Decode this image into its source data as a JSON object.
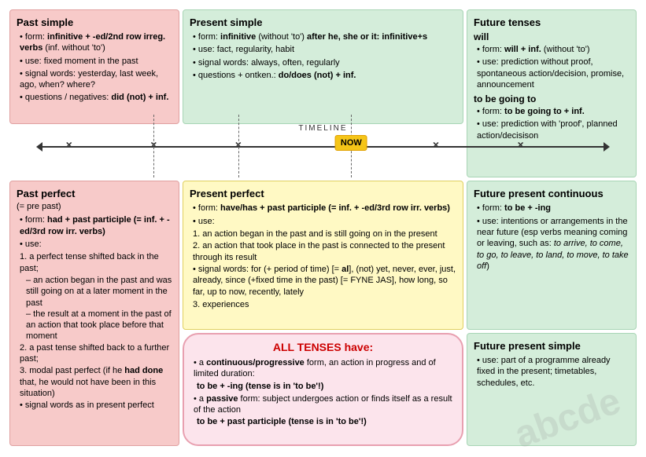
{
  "past_simple": {
    "title": "Past simple",
    "items": [
      {
        "text": "form: ",
        "bold": "infinitive + -ed/2nd row irreg. verbs",
        "rest": " (inf. without 'to')"
      },
      {
        "text": "use: fixed moment in the past"
      },
      {
        "text": "signal words: yesterday, last week, ago, when? where?"
      },
      {
        "text": "questions / negatives: ",
        "bold": "did (not) + inf."
      }
    ]
  },
  "present_simple": {
    "title": "Present simple",
    "items": [
      {
        "text": "form: ",
        "bold": "infinitive",
        "rest": " (without 'to') after he, she or it: ",
        "bold2": "infinitive+s"
      },
      {
        "text": "use: fact, regularity, habit"
      },
      {
        "text": "signal words: always, often, regularly"
      },
      {
        "text": "questions + ontken.: ",
        "bold": "do/does (not) + inf."
      }
    ]
  },
  "future_tenses": {
    "title": "Future tenses",
    "will_title": "will",
    "will_items": [
      {
        "text": "form: ",
        "bold": "will + inf.",
        "rest": " (without 'to')"
      },
      {
        "text": "use: prediction without proof, spontaneous action/decision, promise, announcement"
      }
    ],
    "going_to_title": "to be going to",
    "going_to_items": [
      {
        "text": "form: ",
        "bold": "to be going to + inf."
      },
      {
        "text": "use: prediction with 'proof', planned action/decisison"
      }
    ]
  },
  "timeline": {
    "label": "TIMELINE",
    "now": "NOW"
  },
  "past_perfect": {
    "title": "Past perfect",
    "subtitle": "(= pre past)",
    "items": [
      {
        "text": "form: ",
        "bold": "had + past participle (= inf. + -ed/3rd row irr. verbs)"
      },
      {
        "text": "use:"
      },
      {
        "num": "1.",
        "text": "a perfect tense shifted back in the past;"
      },
      {
        "sub": "– an action began in the past and was still going on at a later moment in the past"
      },
      {
        "sub": "– the result at a moment in the past of an action that took place before that moment"
      },
      {
        "num": "2.",
        "text": "a past tense shifted back to a further past;"
      },
      {
        "num": "3.",
        "text": "modal past perfect (if he ",
        "bold": "had done",
        "rest": " that, he would not have been in this situation)"
      },
      {
        "text": "signal words as in present perfect"
      }
    ]
  },
  "present_perfect": {
    "title": "Present perfect",
    "items": [
      {
        "text": "form: ",
        "bold": "have/has + past participle (= inf. + -ed/3rd row irr. verbs)"
      },
      {
        "text": "use:"
      },
      {
        "num": "1.",
        "text": "an action began in the past and is still going on in the present"
      },
      {
        "num": "2.",
        "text": "an action that took place in the past is connected to the present through its result"
      },
      {
        "text": "signal words: for (+ period of time) [= ",
        "bold": "al",
        "rest": "], (not) yet, never, ever, just, already, since (+fixed time in the past) [= FYNE JAS], how long, so far, up to now, recently, lately"
      },
      {
        "num": "3.",
        "text": "experiences"
      }
    ]
  },
  "future_present_continuous": {
    "title": "Future present continuous",
    "items": [
      {
        "text": "form: ",
        "bold": "to be + -ing"
      },
      {
        "text": "use: intentions or arrangements in the near future (esp verbs meaning coming or leaving, such as: ",
        "italic": "to arrive, to come, to go, to leave, to land, to move, to take off",
        "rest": ")"
      }
    ]
  },
  "future_present_simple": {
    "title": "Future present simple",
    "items": [
      {
        "text": "use: part of a programme already fixed in the present; timetables, schedules, etc."
      }
    ]
  },
  "all_tenses": {
    "title": "ALL TENSES have:",
    "items": [
      {
        "text": "a ",
        "bold": "continuous/progressive",
        "rest": " form, an action in progress and of limited duration:"
      },
      {
        "code": "to be + -ing (tense is in 'to be'!)"
      },
      {
        "text": "a ",
        "bold": "passive",
        "rest": " form: subject undergoes action or finds itself as a result of the action"
      },
      {
        "code": "to be + past participle (tense is in 'to be'!)"
      }
    ]
  },
  "watermark": "abcde"
}
